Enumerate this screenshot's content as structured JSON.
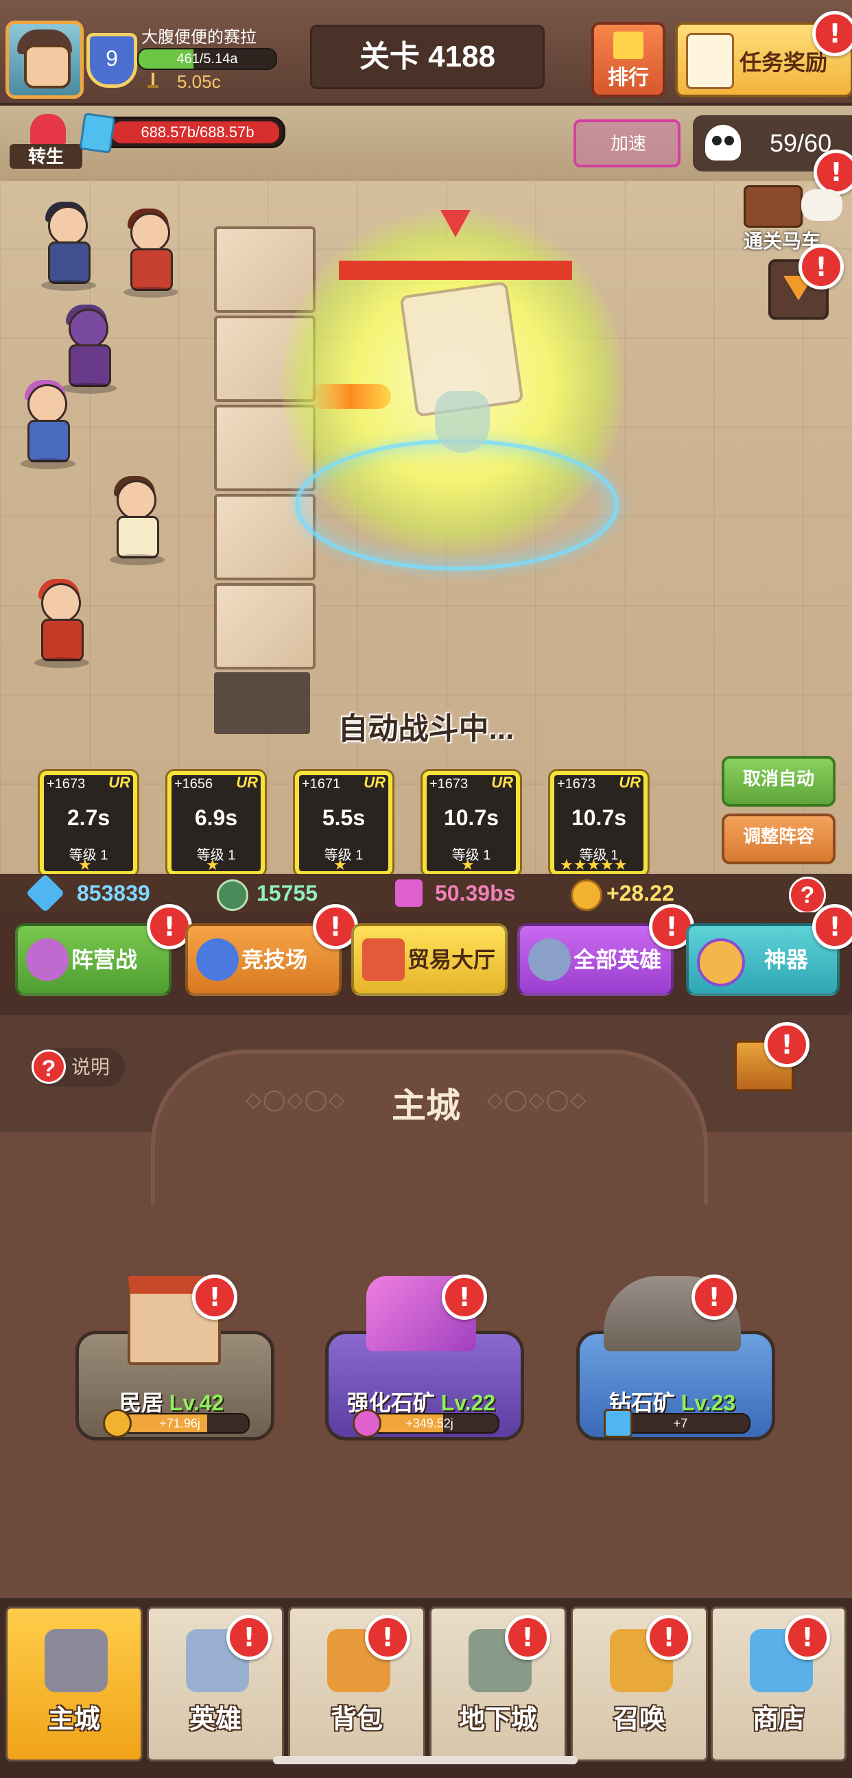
{
  "player": {
    "name": "大腹便便的赛拉",
    "level": "9",
    "xp_text": "461/5.14a",
    "xp_progress": 0.4,
    "power": "5.05c"
  },
  "header": {
    "stage": "关卡 4188",
    "rank_label": "排行",
    "task_label": "任务奖励"
  },
  "battle": {
    "reborn_label": "转生",
    "hp_text": "688.57b/688.57b",
    "speed_label": "加速",
    "kill_count": "59/60",
    "carriage_label": "通关马车",
    "auto_status": "自动战斗中...",
    "cancel_auto": "取消自动",
    "adjust_lineup": "调整阵容"
  },
  "skills": [
    {
      "bonus": "+1673",
      "rarity": "UR",
      "cooldown": "2.7s",
      "level": "等级 1",
      "stars": "★"
    },
    {
      "bonus": "+1656",
      "rarity": "UR",
      "cooldown": "6.9s",
      "level": "等级 1",
      "stars": "★"
    },
    {
      "bonus": "+1671",
      "rarity": "UR",
      "cooldown": "5.5s",
      "level": "等级 1",
      "stars": "★"
    },
    {
      "bonus": "+1673",
      "rarity": "UR",
      "cooldown": "10.7s",
      "level": "等级 1",
      "stars": "★"
    },
    {
      "bonus": "+1673",
      "rarity": "UR",
      "cooldown": "10.7s",
      "level": "等级 1",
      "stars": "★★★★★"
    }
  ],
  "currency": {
    "diamond": "853839",
    "token": "15755",
    "crystal": "50.39bs",
    "gold": "+28.22"
  },
  "features": [
    {
      "label": "阵营战"
    },
    {
      "label": "竞技场"
    },
    {
      "label": "贸易大厅"
    },
    {
      "label": "全部英雄"
    },
    {
      "label": "神器"
    }
  ],
  "city": {
    "title": "主城",
    "help_label": "说明",
    "buildings": [
      {
        "name": "民居",
        "level": "Lv.42",
        "rate": "+71.96j",
        "progress": 0.7
      },
      {
        "name": "强化石矿",
        "level": "Lv.22",
        "rate": "+349.52j",
        "progress": 0.6
      },
      {
        "name": "钻石矿",
        "level": "Lv.23",
        "rate": "+7",
        "progress": 0.1
      }
    ]
  },
  "nav": [
    {
      "label": "主城"
    },
    {
      "label": "英雄"
    },
    {
      "label": "背包"
    },
    {
      "label": "地下城"
    },
    {
      "label": "召唤"
    },
    {
      "label": "商店"
    }
  ],
  "colors": {
    "badge": "#e53331",
    "level_green": "#8ef05a",
    "skill_frame": "#f6e13a"
  }
}
